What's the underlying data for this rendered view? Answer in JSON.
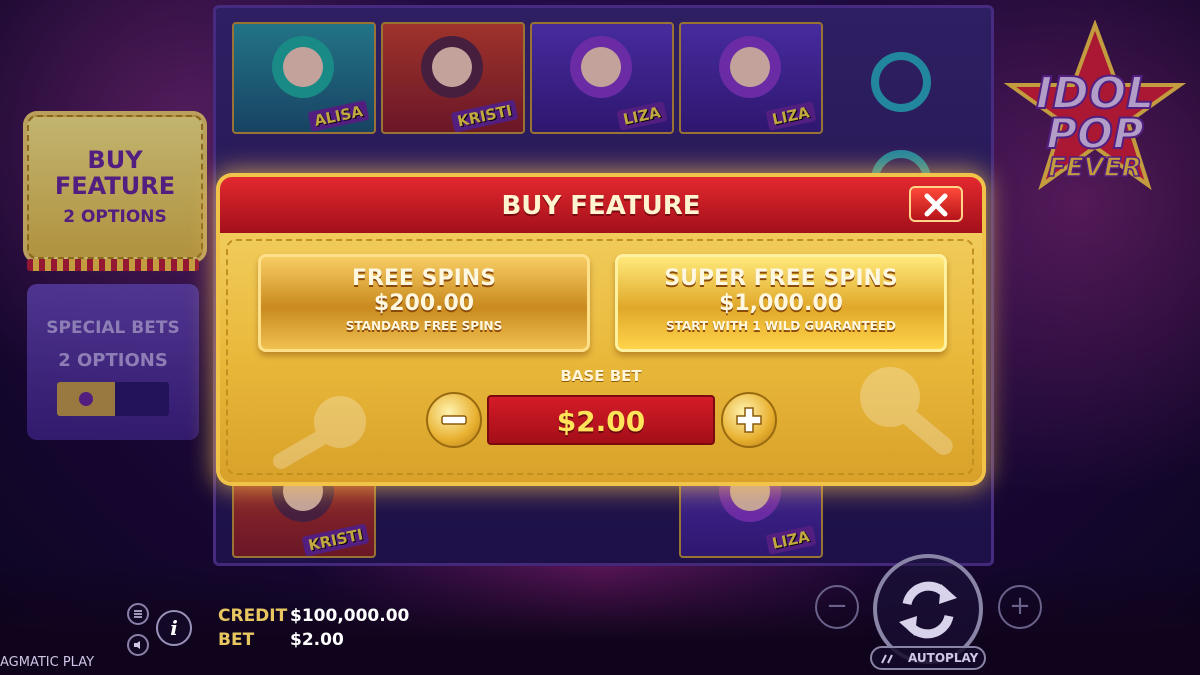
{
  "game": {
    "logo": {
      "line1": "IDOL",
      "line2": "POP",
      "line3": "FEVER"
    }
  },
  "reels": {
    "names": [
      "ALISA",
      "KRISTI",
      "LIZA",
      "LIZA",
      "KRISTI",
      "LIZA"
    ]
  },
  "side_panel": {
    "buy_feature": {
      "title": "BUY FEATURE",
      "subtitle": "2 OPTIONS"
    },
    "special_bets": {
      "title": "SPECIAL BETS",
      "subtitle": "2 OPTIONS"
    }
  },
  "modal": {
    "title": "BUY FEATURE",
    "options": [
      {
        "name": "FREE SPINS",
        "price": "$200.00",
        "description": "STANDARD FREE SPINS"
      },
      {
        "name": "SUPER FREE SPINS",
        "price": "$1,000.00",
        "description": "START WITH 1 WILD GUARANTEED"
      }
    ],
    "base_bet_label": "BASE BET",
    "base_bet_value": "$2.00"
  },
  "hud": {
    "credit_label": "CREDIT",
    "credit_value": "$100,000.00",
    "bet_label": "BET",
    "bet_value": "$2.00",
    "autoplay_label": "AUTOPLAY",
    "provider": "AGMATIC PLAY"
  },
  "colors": {
    "modal_header": "#c8161f",
    "modal_body": "#e8b83a",
    "bet_value": "#ffe45a",
    "accent_purple": "#6a2aa0"
  }
}
